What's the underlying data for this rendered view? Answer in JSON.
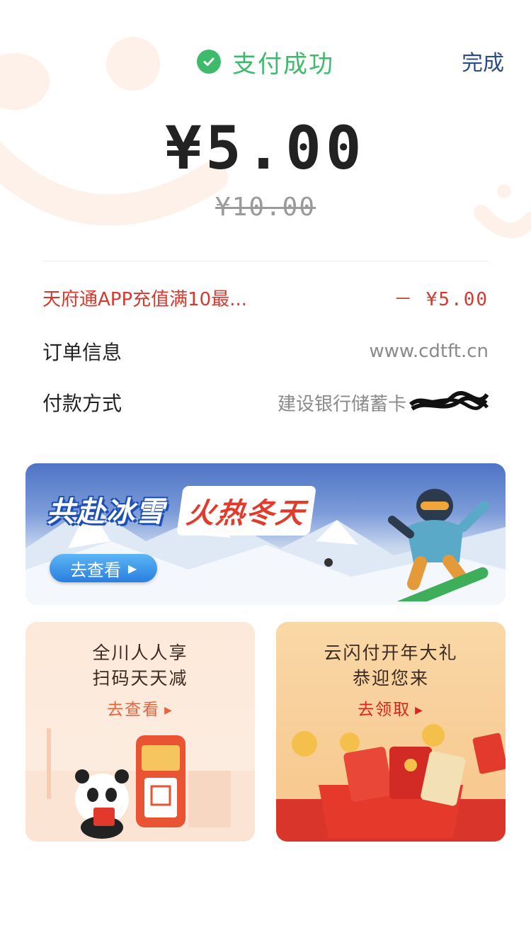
{
  "header": {
    "status_text": "支付成功",
    "done_label": "完成"
  },
  "payment": {
    "amount": "¥5.00",
    "original_amount": "¥10.00"
  },
  "details": {
    "discount_label": "天府通APP充值满10最...",
    "discount_value": "－ ¥5.00",
    "order_label": "订单信息",
    "order_value": "www.cdtft.cn",
    "pay_label": "付款方式",
    "pay_value": "建设银行储蓄卡"
  },
  "banner": {
    "title_part1": "共赴冰雪",
    "title_part2": "火热冬天",
    "button_label": "去查看"
  },
  "cards": [
    {
      "line1": "全川人人享",
      "line2": "扫码天天减",
      "cta": "去查看"
    },
    {
      "line1": "云闪付开年大礼",
      "line2": "恭迎您来",
      "cta": "去领取"
    }
  ],
  "colors": {
    "success_green": "#3dbb6a",
    "discount_red": "#d43a2f",
    "done_blue": "#2c4b8c"
  },
  "icons": {
    "status": "check-circle-icon",
    "banner_arrow": "play-arrow-icon",
    "card_arrow": "caret-right-icon"
  }
}
